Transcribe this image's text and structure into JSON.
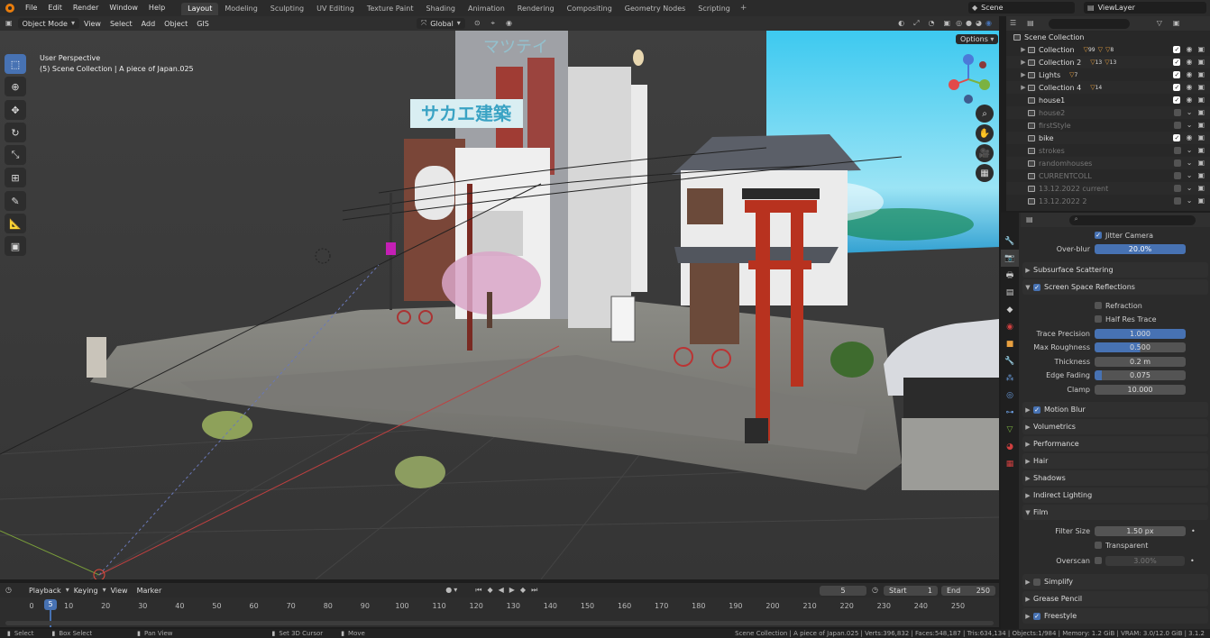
{
  "menubar": {
    "menus": [
      "File",
      "Edit",
      "Render",
      "Window",
      "Help"
    ],
    "workspaces": [
      "Layout",
      "Modeling",
      "Sculpting",
      "UV Editing",
      "Texture Paint",
      "Shading",
      "Animation",
      "Rendering",
      "Compositing",
      "Geometry Nodes",
      "Scripting"
    ],
    "active_workspace": "Layout",
    "scene": "Scene",
    "view_layer": "ViewLayer"
  },
  "viewport_header": {
    "mode": "Object Mode",
    "menus": [
      "View",
      "Select",
      "Add",
      "Object",
      "GIS"
    ],
    "transform_orientation": "Global",
    "options": "Options"
  },
  "viewport": {
    "view_name": "User Perspective",
    "collection_info": "(5) Scene Collection | A piece of Japan.025",
    "signs": [
      "サカエ建築",
      "マツテイ"
    ]
  },
  "outliner": {
    "root": "Scene Collection",
    "items": [
      {
        "name": "Collection",
        "has_tri": true,
        "counts": [
          "99",
          "",
          "8"
        ],
        "enabled": true,
        "dim": false
      },
      {
        "name": "Collection 2",
        "has_tri": true,
        "counts": [
          "13",
          "13"
        ],
        "enabled": true,
        "dim": false
      },
      {
        "name": "Lights",
        "has_tri": true,
        "counts": [
          "7"
        ],
        "enabled": true,
        "dim": false
      },
      {
        "name": "Collection 4",
        "has_tri": true,
        "counts": [
          "14"
        ],
        "enabled": true,
        "dim": false
      },
      {
        "name": "house1",
        "has_tri": false,
        "counts": [],
        "enabled": true,
        "dim": false
      },
      {
        "name": "house2",
        "has_tri": false,
        "counts": [],
        "enabled": false,
        "dim": true
      },
      {
        "name": "firstStyle",
        "has_tri": false,
        "counts": [],
        "enabled": false,
        "dim": true
      },
      {
        "name": "bike",
        "has_tri": false,
        "counts": [],
        "enabled": true,
        "dim": false
      },
      {
        "name": "strokes",
        "has_tri": false,
        "counts": [],
        "enabled": false,
        "dim": true
      },
      {
        "name": "randomhouses",
        "has_tri": false,
        "counts": [],
        "enabled": false,
        "dim": true
      },
      {
        "name": "CURRENTCOLL",
        "has_tri": false,
        "counts": [],
        "enabled": false,
        "dim": true
      },
      {
        "name": "13.12.2022 current",
        "has_tri": false,
        "counts": [],
        "enabled": false,
        "dim": true
      },
      {
        "name": "13.12.2022 2",
        "has_tri": false,
        "counts": [],
        "enabled": false,
        "dim": true
      }
    ]
  },
  "properties": {
    "jitter_camera": "Jitter Camera",
    "overblur_label": "Over-blur",
    "overblur_value": "20.0%",
    "subsurface": "Subsurface Scattering",
    "ssr": "Screen Space Reflections",
    "refraction": "Refraction",
    "half_res": "Half Res Trace",
    "fields": [
      {
        "label": "Trace Precision",
        "value": "1.000",
        "fill": 1.0
      },
      {
        "label": "Max Roughness",
        "value": "0.500",
        "fill": 0.5
      },
      {
        "label": "Thickness",
        "value": "0.2 m",
        "fill": 0
      },
      {
        "label": "Edge Fading",
        "value": "0.075",
        "fill": 0.075
      },
      {
        "label": "Clamp",
        "value": "10.000",
        "fill": 0
      }
    ],
    "panels": [
      "Motion Blur",
      "Volumetrics",
      "Performance",
      "Hair",
      "Shadows",
      "Indirect Lighting",
      "Film"
    ],
    "filter_size_label": "Filter Size",
    "filter_size": "1.50 px",
    "transparent": "Transparent",
    "overscan_label": "Overscan",
    "overscan": "3.00%",
    "panels2": [
      "Simplify",
      "Grease Pencil",
      "Freestyle"
    ]
  },
  "timeline": {
    "menus": [
      "Playback",
      "Keying",
      "View",
      "Marker"
    ],
    "current_frame": "5",
    "start_label": "Start",
    "start": "1",
    "end_label": "End",
    "end": "250",
    "frame": "5",
    "ticks": [
      "0",
      "10",
      "20",
      "30",
      "40",
      "50",
      "60",
      "70",
      "80",
      "90",
      "100",
      "110",
      "120",
      "130",
      "140",
      "150",
      "160",
      "170",
      "180",
      "190",
      "200",
      "210",
      "220",
      "230",
      "240",
      "250"
    ]
  },
  "statusbar": {
    "select": "Select",
    "box_select": "Box Select",
    "pan_view": "Pan View",
    "set_cursor": "Set 3D Cursor",
    "move": "Move",
    "stats": "Scene Collection | A piece of Japan.025 | Verts:396,832 | Faces:548,187 | Tris:634,134 | Objects:1/984 | Memory: 1.2 GiB | VRAM: 3.0/12.0 GiB | 3.1.2"
  },
  "colors": {
    "accent": "#4772b3",
    "brand": "#e87d0d",
    "torii": "#b8321f"
  }
}
